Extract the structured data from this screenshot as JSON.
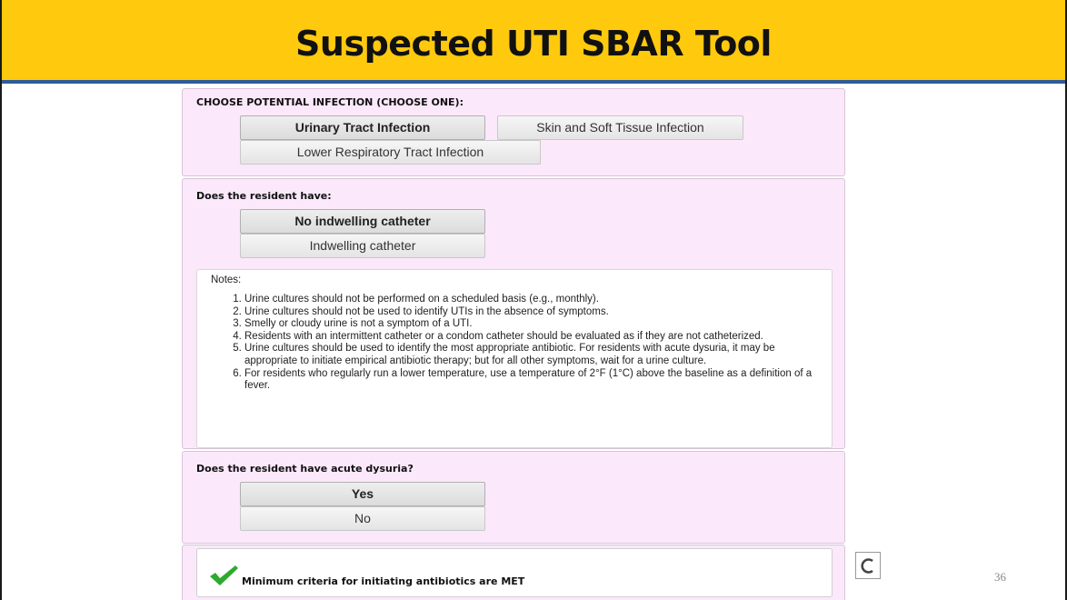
{
  "slide": {
    "title": "Suspected UTI SBAR Tool",
    "page_number": "36"
  },
  "infection": {
    "label": "CHOOSE POTENTIAL INFECTION (CHOOSE ONE):",
    "options": [
      "Urinary Tract Infection",
      "Skin and Soft Tissue Infection",
      "Lower Respiratory Tract Infection"
    ],
    "selected": "Urinary Tract Infection"
  },
  "catheter": {
    "label": "Does the resident have:",
    "options": [
      "No indwelling catheter",
      "Indwelling catheter"
    ],
    "selected": "No indwelling catheter"
  },
  "notes": {
    "title": "Notes:",
    "items": [
      "Urine cultures should not be performed on a scheduled basis (e.g., monthly).",
      "Urine cultures should not be used to identify UTIs in the absence of symptoms.",
      "Smelly or cloudy urine is not a symptom of a UTI.",
      "Residents with an intermittent catheter or a condom catheter should be evaluated as if they are not catheterized.",
      "Urine cultures should be used to identify the most appropriate antibiotic. For residents with acute dysuria, it may be appropriate to initiate empirical antibiotic therapy; but for all other symptoms, wait for a urine culture.",
      "For residents who regularly run a lower temperature, use a temperature of 2°F (1°C) above the baseline as a definition of a fever."
    ]
  },
  "dysuria": {
    "label": "Does the resident have acute dysuria?",
    "options": [
      "Yes",
      "No"
    ],
    "selected": "Yes"
  },
  "result": {
    "text": "Minimum criteria for initiating antibiotics are MET",
    "icon": "checkmark-icon",
    "color": "#2eaa2e"
  },
  "colors": {
    "title_bg": "#ffc90e",
    "title_rule": "#2e5c9a",
    "panel_bg": "#fbe8fb"
  }
}
